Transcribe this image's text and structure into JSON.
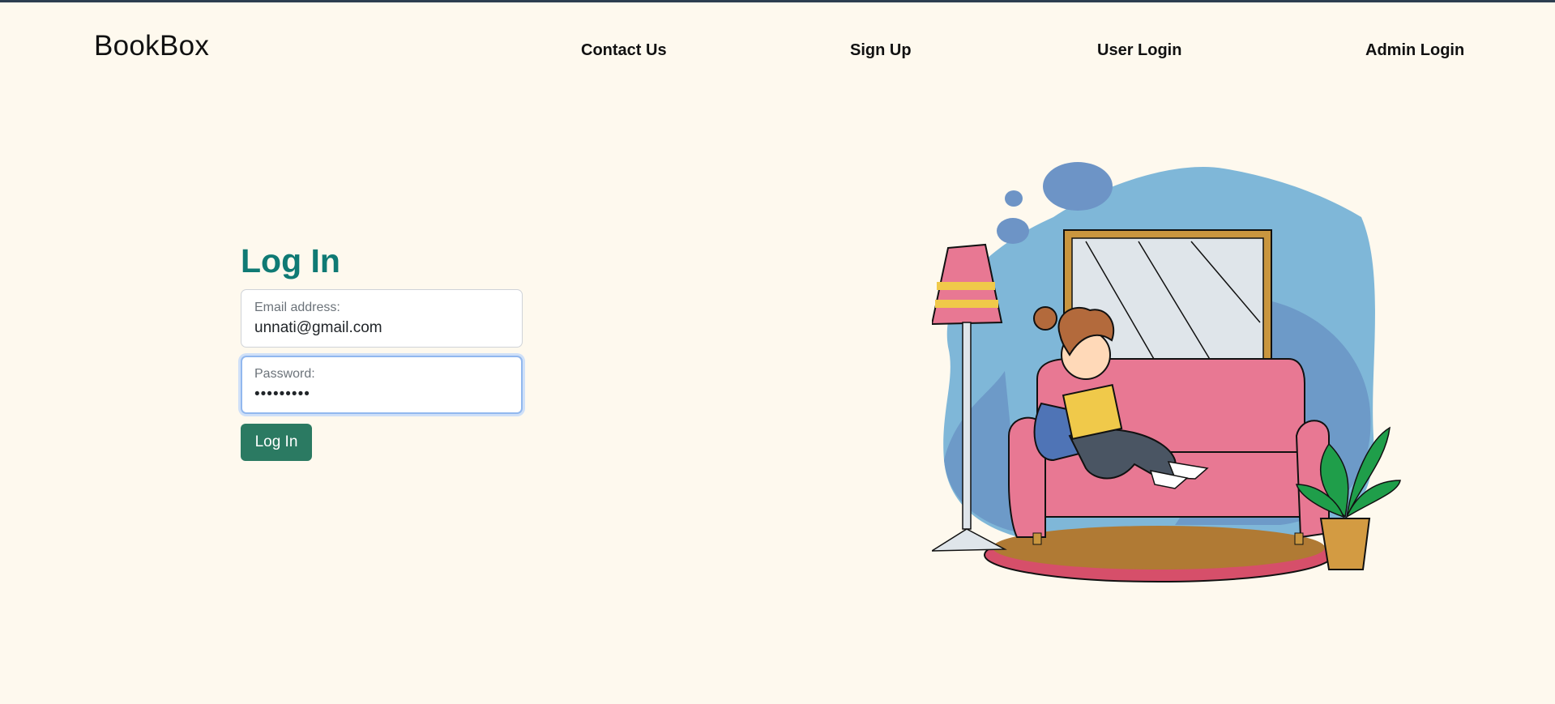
{
  "brand": "BookBox",
  "nav": {
    "contact": "Contact Us",
    "signup": "Sign Up",
    "user_login": "User Login",
    "admin_login": "Admin Login"
  },
  "login": {
    "title": "Log In",
    "email": {
      "label": "Email address:",
      "value": "unnati@gmail.com"
    },
    "password": {
      "label": "Password:",
      "value": "•••••••••"
    },
    "submit": "Log In"
  },
  "colors": {
    "background": "#fef9ee",
    "title": "#0f7a74",
    "button": "#2b7a62",
    "focus_ring": "#cfe0f8"
  },
  "illustration": {
    "icon": "girl-reading-on-sofa-illustration"
  }
}
